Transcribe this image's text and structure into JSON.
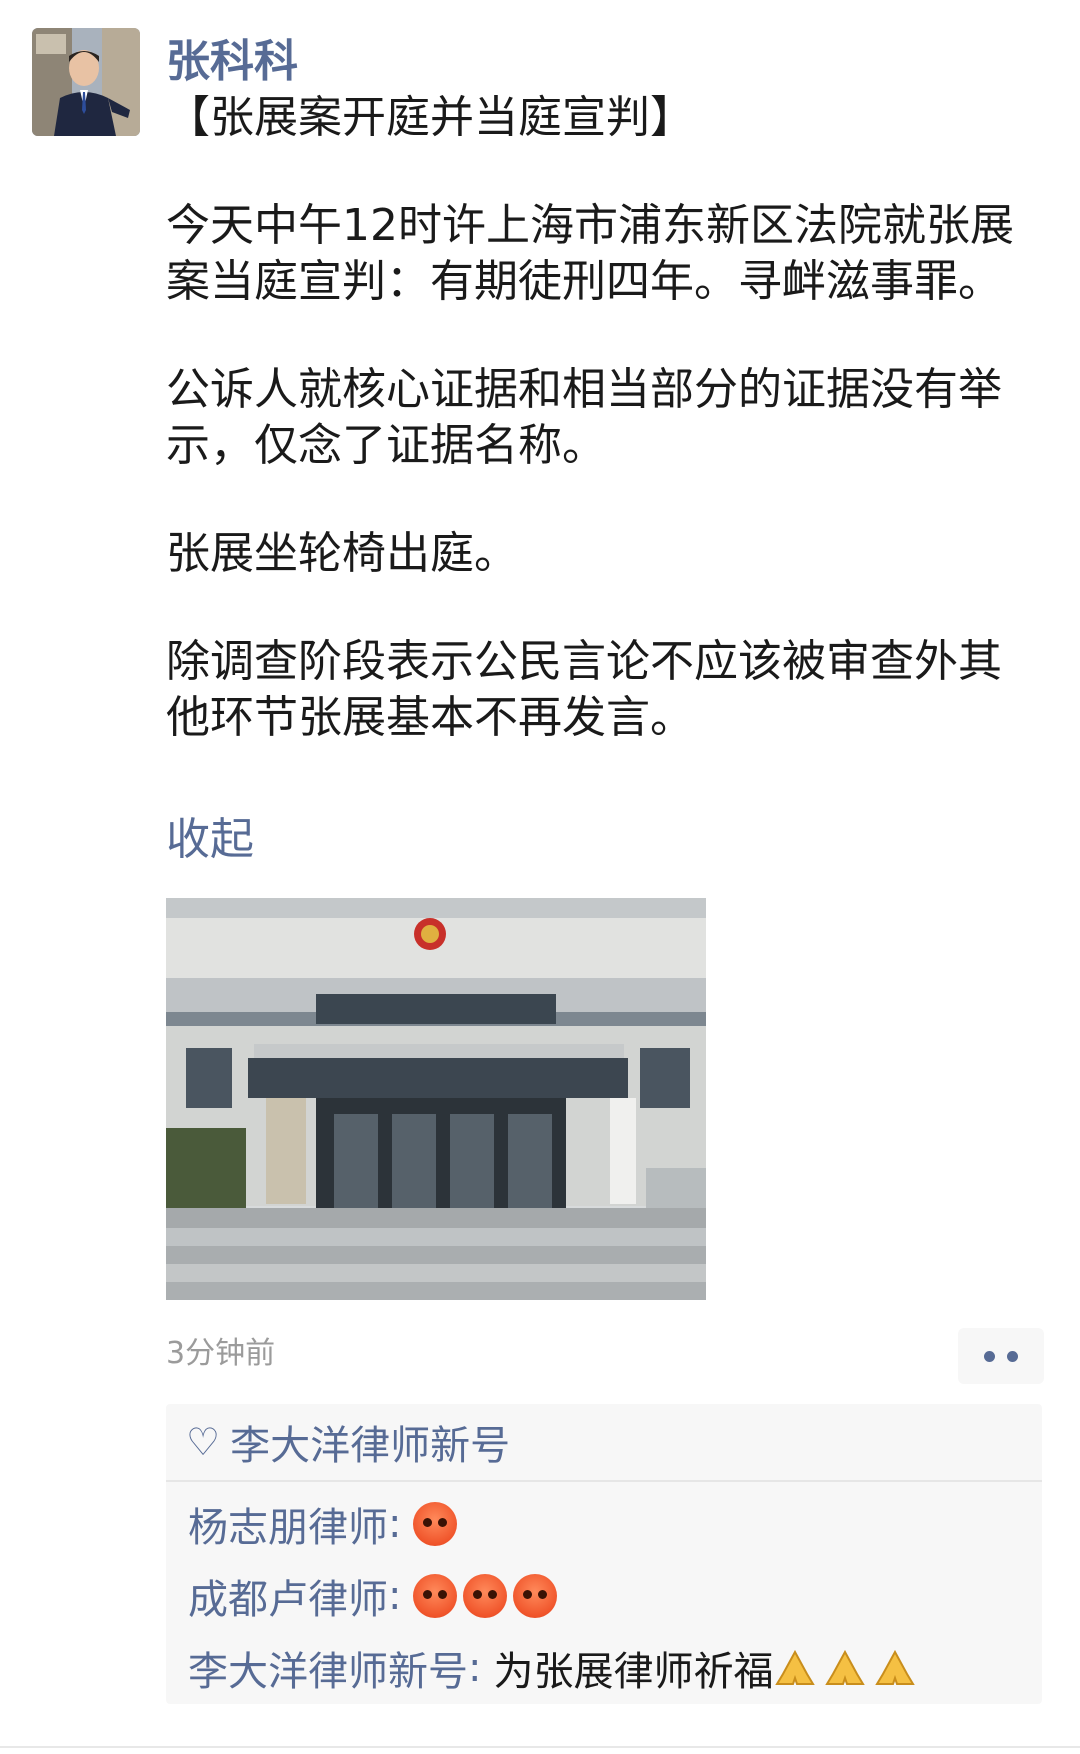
{
  "post": {
    "author": "张科科",
    "title": "【张展案开庭并当庭宣判】",
    "paragraphs": [
      "今天中午12时许上海市浦东新区法院就张展案当庭宣判：有期徒刑四年。寻衅滋事罪。",
      "公诉人就核心证据和相当部分的证据没有举示，仅念了证据名称。",
      "张展坐轮椅出庭。",
      "除调查阶段表示公民言论不应该被审查外其他环节张展基本不再发言。"
    ],
    "collapse_label": "收起",
    "timestamp": "3分钟前"
  },
  "interactions": {
    "like_icon": "heart-outline-icon",
    "likes": "李大洋律师新号",
    "comments": [
      {
        "name": "杨志朋律师",
        "colon": ":",
        "text": "",
        "emojis": [
          "angry-face-icon"
        ]
      },
      {
        "name": "成都卢律师",
        "colon": ":",
        "text": "",
        "emojis": [
          "angry-face-icon",
          "angry-face-icon",
          "angry-face-icon"
        ]
      },
      {
        "name": "李大洋律师新号",
        "colon": ":",
        "text": "为张展律师祈福",
        "emojis": [
          "folded-hands-icon",
          "folded-hands-icon",
          "folded-hands-icon"
        ]
      }
    ]
  },
  "colors": {
    "link": "#576b95",
    "text": "#1a1a1a",
    "meta": "#9b9b9b",
    "panel": "#f7f7f7"
  }
}
